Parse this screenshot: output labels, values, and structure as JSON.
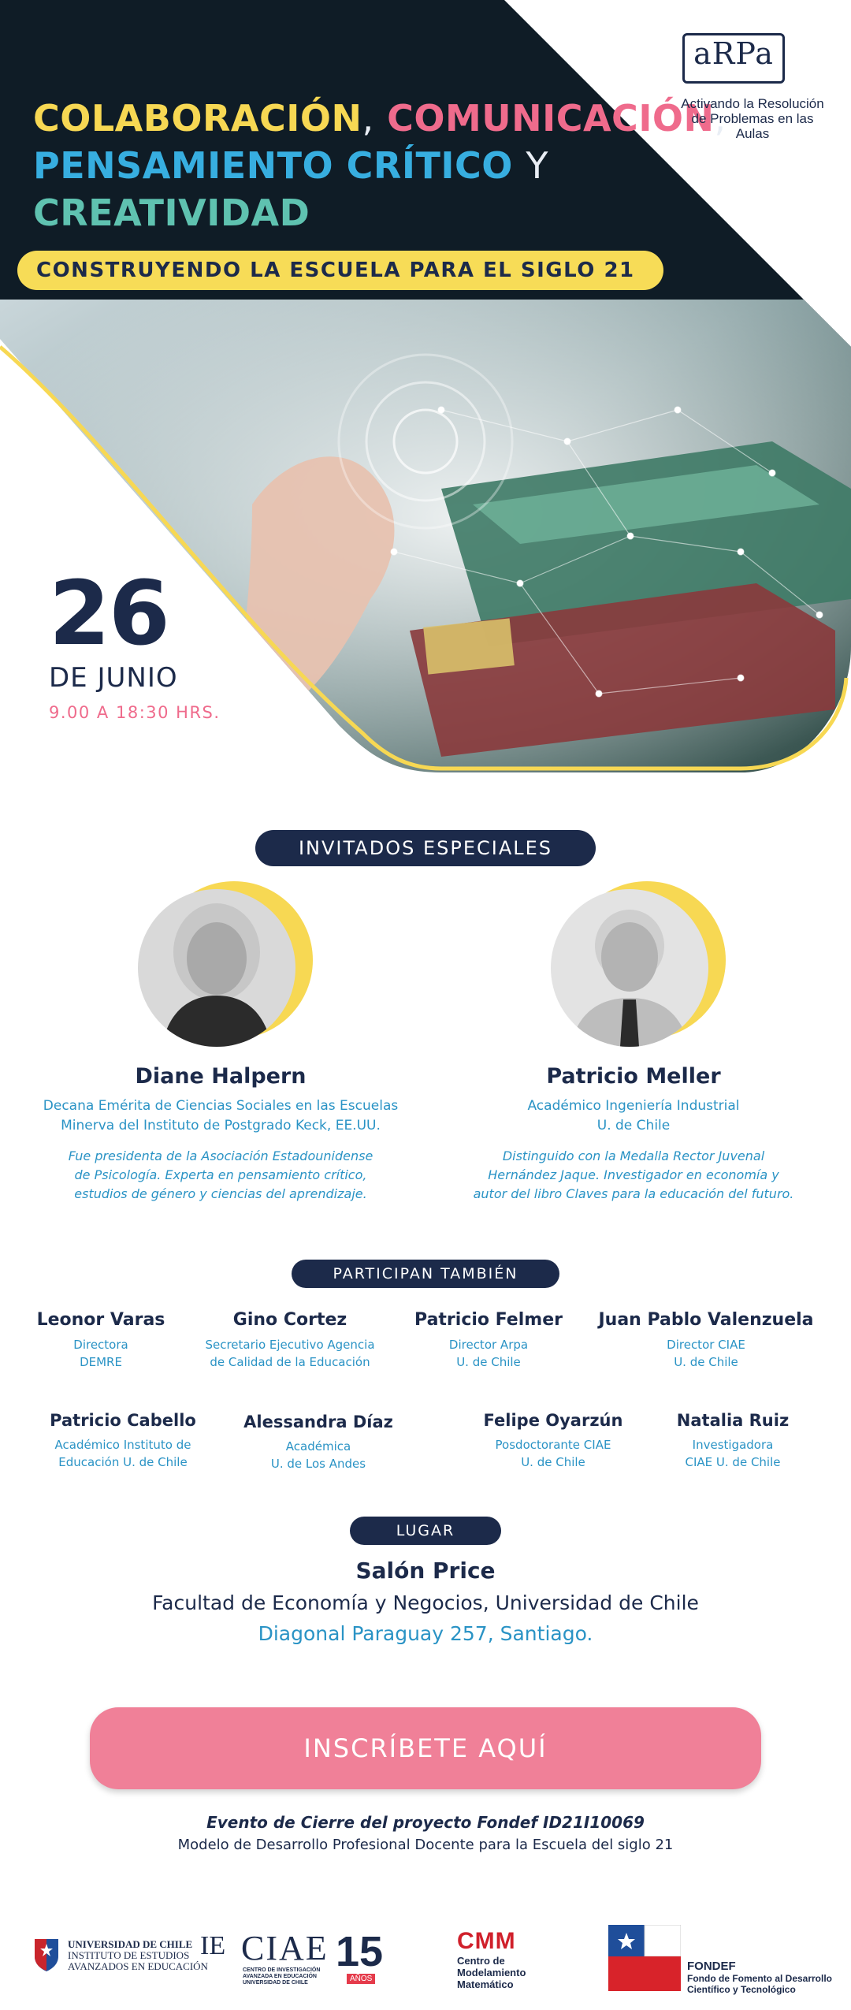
{
  "headline": {
    "word1": "COLABORACIÓN",
    "comma1": ",",
    "word2": "COMUNICACIÓN",
    "comma2": ",",
    "word3": "PENSAMIENTO CRÍTICO",
    "conj": "Y",
    "word4": "CREATIVIDAD"
  },
  "tagline": "CONSTRUYENDO LA ESCUELA PARA EL SIGLO 21",
  "logo_arpa": {
    "word": "aRPa",
    "sub_line1": "Activando la Resolución",
    "sub_line2": "de Problemas en las Aulas"
  },
  "event_date": {
    "day": "26",
    "month": "DE JUNIO",
    "hours": "9.00 A 18:30 HRS."
  },
  "sections": {
    "invitados": "INVITADOS ESPECIALES",
    "participan": "PARTICIPAN TAMBIÉN",
    "lugar": "LUGAR"
  },
  "guests": [
    {
      "name": "Diane Halpern",
      "role_line1": "Decana Emérita de Ciencias Sociales en las Escuelas",
      "role_line2": "Minerva del Instituto de Postgrado Keck, EE.UU.",
      "bio_line1": "Fue presidenta de la Asociación Estadounidense",
      "bio_line2": "de Psicología. Experta en pensamiento crítico,",
      "bio_line3": "estudios de género y ciencias del aprendizaje."
    },
    {
      "name": "Patricio Meller",
      "role_line1": "Académico Ingeniería Industrial",
      "role_line2": "U. de Chile",
      "bio_line1": "Distinguido con la Medalla Rector Juvenal",
      "bio_line2": "Hernández Jaque. Investigador en economía y",
      "bio_line3": "autor del libro Claves para la educación del futuro."
    }
  ],
  "participants": [
    {
      "name": "Leonor Varas",
      "role_line1": "Directora",
      "role_line2": "DEMRE"
    },
    {
      "name": "Gino Cortez",
      "role_line1": "Secretario Ejecutivo Agencia",
      "role_line2": "de Calidad de la Educación"
    },
    {
      "name": "Patricio Felmer",
      "role_line1": "Director Arpa",
      "role_line2": "U. de Chile"
    },
    {
      "name": "Juan Pablo Valenzuela",
      "role_line1": "Director CIAE",
      "role_line2": "U. de Chile"
    },
    {
      "name": "Patricio Cabello",
      "role_line1": "Académico Instituto de",
      "role_line2": "Educación U. de Chile"
    },
    {
      "name": "Alessandra Díaz",
      "role_line1": "Académica",
      "role_line2": "U. de Los Andes"
    },
    {
      "name": "Felipe Oyarzún",
      "role_line1": "Posdoctorante CIAE",
      "role_line2": "U. de Chile"
    },
    {
      "name": "Natalia Ruiz",
      "role_line1": "Investigadora",
      "role_line2": "CIAE U. de Chile"
    }
  ],
  "venue": {
    "name": "Salón Price",
    "faculty": "Facultad de Economía y Negocios, Universidad de Chile",
    "address": "Diagonal Paraguay 257, Santiago."
  },
  "cta_label": "INSCRÍBETE AQUÍ",
  "closing": {
    "title": "Evento de Cierre del proyecto Fondef ID21I10069",
    "subtitle": "Modelo de Desarrollo Profesional Docente para la Escuela del siglo 21"
  },
  "footer": {
    "uchile_line1": "UNIVERSIDAD DE CHILE",
    "uchile_line2": "INSTITUTO DE ESTUDIOS",
    "uchile_line3": "AVANZADOS EN EDUCACIÓN",
    "ie": "IE",
    "ciae": "CIAE",
    "ciae_sub1": "CENTRO DE INVESTIGACIÓN",
    "ciae_sub2": "AVANZADA EN EDUCACIÓN",
    "ciae_sub3": "UNIVERSIDAD DE CHILE",
    "ciae_years": "15",
    "ciae_anos": "AÑOS",
    "cmm": "CMM",
    "cmm_sub1": "Centro de",
    "cmm_sub2": "Modelamiento",
    "cmm_sub3": "Matemático",
    "fondef": "FONDEF",
    "fondef_sub1": "Fondo de Fomento al Desarrollo",
    "fondef_sub2": "Científico y Tecnológico"
  },
  "colors": {
    "navy": "#1c2a4a",
    "yellow": "#f7d853",
    "pink": "#ef6b8c",
    "blue": "#37aee0",
    "teal": "#5fc2b0",
    "cta": "#f08098"
  }
}
